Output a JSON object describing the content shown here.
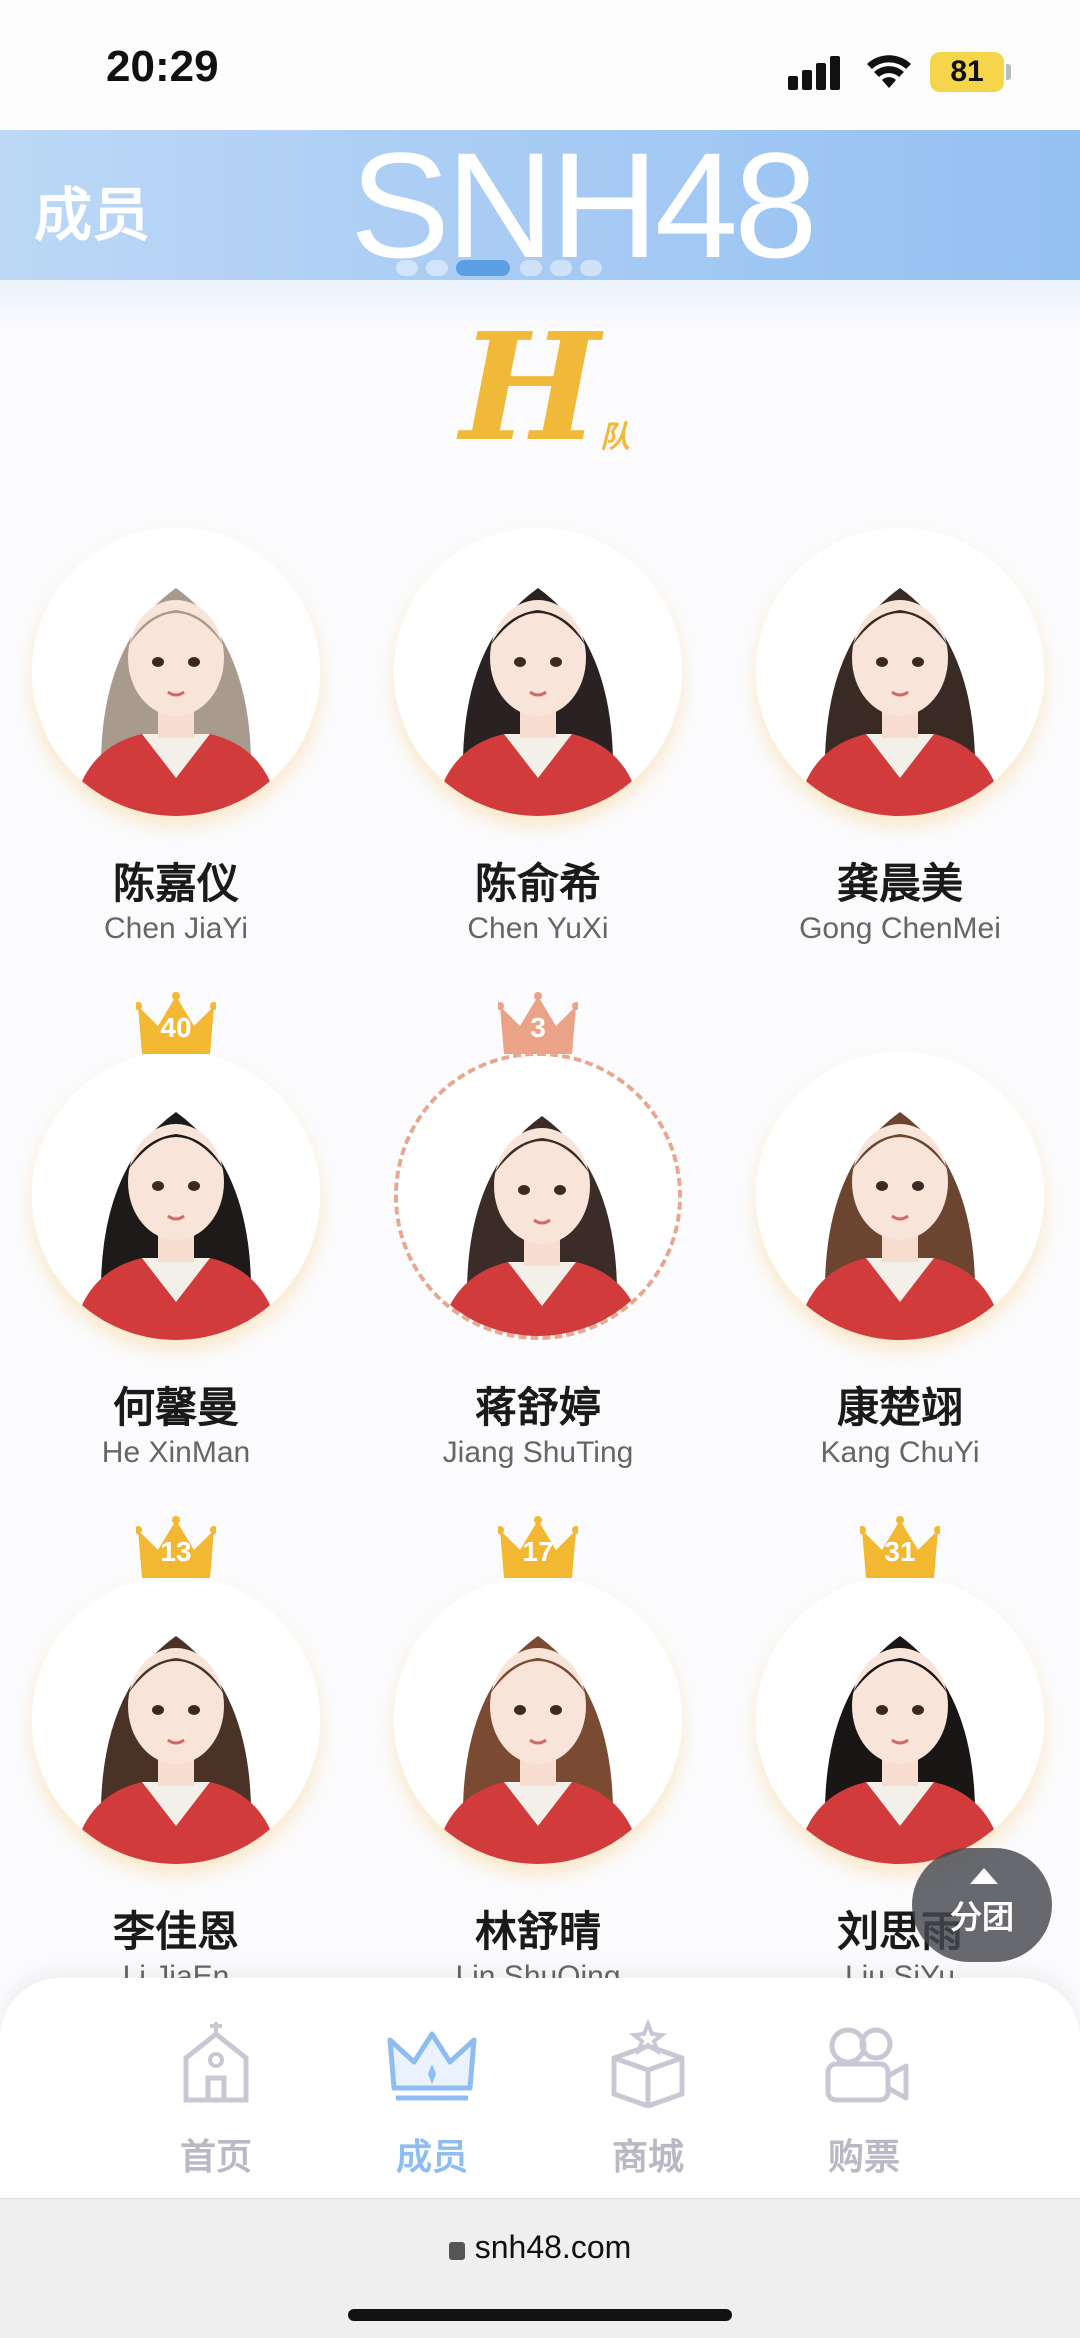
{
  "status_bar": {
    "time": "20:29",
    "battery": "81"
  },
  "header": {
    "title": "成员",
    "brand": "SNH48",
    "carousel_active_index": 2,
    "carousel_count": 6
  },
  "team": {
    "letter": "H",
    "sub": "队"
  },
  "members": [
    {
      "name_cn": "陈嘉仪",
      "name_en": "Chen JiaYi",
      "crown": null,
      "hair": "#a89a8c"
    },
    {
      "name_cn": "陈俞希",
      "name_en": "Chen YuXi",
      "crown": null,
      "hair": "#2a2222"
    },
    {
      "name_cn": "龚晨美",
      "name_en": "Gong ChenMei",
      "crown": null,
      "hair": "#3a2a24"
    },
    {
      "name_cn": "何馨曼",
      "name_en": "He XinMan",
      "crown": "40",
      "crown_color": "#f2b832",
      "hair": "#1e1a1a"
    },
    {
      "name_cn": "蒋舒婷",
      "name_en": "Jiang ShuTing",
      "crown": "3",
      "crown_color": "#eaa386",
      "hair": "#3b2c27",
      "dashed": true
    },
    {
      "name_cn": "康楚翊",
      "name_en": "Kang ChuYi",
      "crown": null,
      "hair": "#6b4530"
    },
    {
      "name_cn": "李佳恩",
      "name_en": "Li JiaEn",
      "crown": "13",
      "crown_color": "#f2b832",
      "hair": "#4a3226"
    },
    {
      "name_cn": "林舒晴",
      "name_en": "Lin ShuQing",
      "crown": "17",
      "crown_color": "#f2b832",
      "hair": "#7a4a32"
    },
    {
      "name_cn": "刘思雨",
      "name_en": "Liu SiYu",
      "crown": "31",
      "crown_color": "#f2b832",
      "hair": "#1a1616"
    }
  ],
  "float_button": {
    "label": "分团"
  },
  "nav": {
    "items": [
      {
        "label": "首页",
        "icon": "home-icon"
      },
      {
        "label": "成员",
        "icon": "crown-icon",
        "active": true
      },
      {
        "label": "商城",
        "icon": "gift-box-icon"
      },
      {
        "label": "购票",
        "icon": "camera-icon"
      }
    ]
  },
  "url": "snh48.com",
  "colors": {
    "accent": "#8fbdf0",
    "gold": "#f2b832",
    "inactive": "#b9b9c6"
  }
}
